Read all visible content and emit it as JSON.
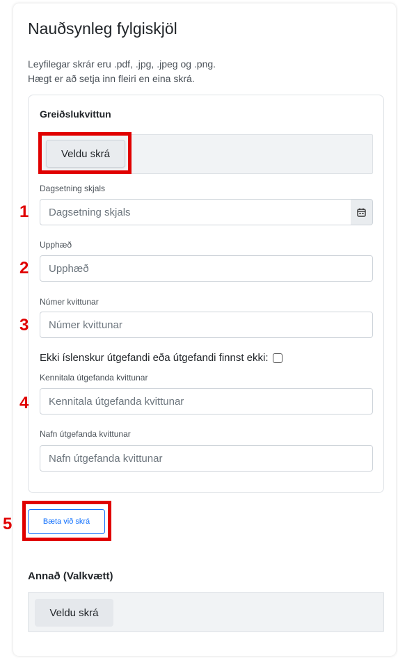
{
  "page": {
    "title": "Nauðsynleg fylgiskjöl",
    "description_line1": "Leyfilegar skrár eru .pdf, .jpg, .jpeg og .png.",
    "description_line2": "Hægt er að setja inn fleiri en eina skrá."
  },
  "receipt": {
    "section_title": "Greiðslukvittun",
    "choose_file_label": "Veldu skrá",
    "date_label": "Dagsetning skjals",
    "date_placeholder": "Dagsetning skjals",
    "amount_label": "Upphæð",
    "amount_placeholder": "Upphæð",
    "receipt_number_label": "Númer kvittunar",
    "receipt_number_placeholder": "Númer kvittunar",
    "foreign_issuer_label": "Ekki íslenskur útgefandi eða útgefandi finnst ekki:",
    "issuer_id_label": "Kennitala útgefanda kvittunar",
    "issuer_id_placeholder": "Kennitala útgefanda kvittunar",
    "issuer_name_label": "Nafn útgefanda kvittunar",
    "issuer_name_placeholder": "Nafn útgefanda kvittunar"
  },
  "add_file_label": "Bæta við skrá",
  "other": {
    "section_title": "Annað (Valkvætt)",
    "choose_file_label": "Veldu skrá"
  },
  "annotations": [
    "1",
    "2",
    "3",
    "4",
    "5"
  ],
  "icons": {
    "calendar": "calendar-icon"
  },
  "colors": {
    "highlight": "#e00000",
    "primary": "#0d6efd"
  }
}
